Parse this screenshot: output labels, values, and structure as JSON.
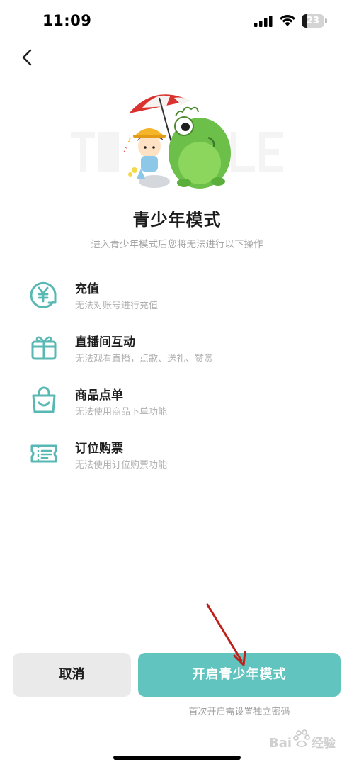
{
  "status_bar": {
    "time": "11:09",
    "battery": "23",
    "battery_level": 0.23
  },
  "page": {
    "title": "青少年模式",
    "subtitle": "进入青少年模式后您将无法进行以下操作"
  },
  "features": [
    {
      "icon": "yen-coin-icon",
      "title": "充值",
      "desc": "无法对账号进行充值"
    },
    {
      "icon": "gift-box-icon",
      "title": "直播间互动",
      "desc": "无法观看直播，点歌、送礼、赞赏"
    },
    {
      "icon": "shopping-bag-icon",
      "title": "商品点单",
      "desc": "无法使用商品下单功能"
    },
    {
      "icon": "ticket-icon",
      "title": "订位购票",
      "desc": "无法使用订位购票功能"
    }
  ],
  "actions": {
    "cancel_label": "取消",
    "open_label": "开启青少年模式",
    "hint": "首次开启需设置独立密码"
  },
  "colors": {
    "accent": "#62c4bf",
    "icon": "#5ab8b4",
    "cancel_bg": "#eaeaea",
    "annotation_arrow": "#c0201a"
  },
  "watermark": {
    "text": "Baidu经验"
  }
}
